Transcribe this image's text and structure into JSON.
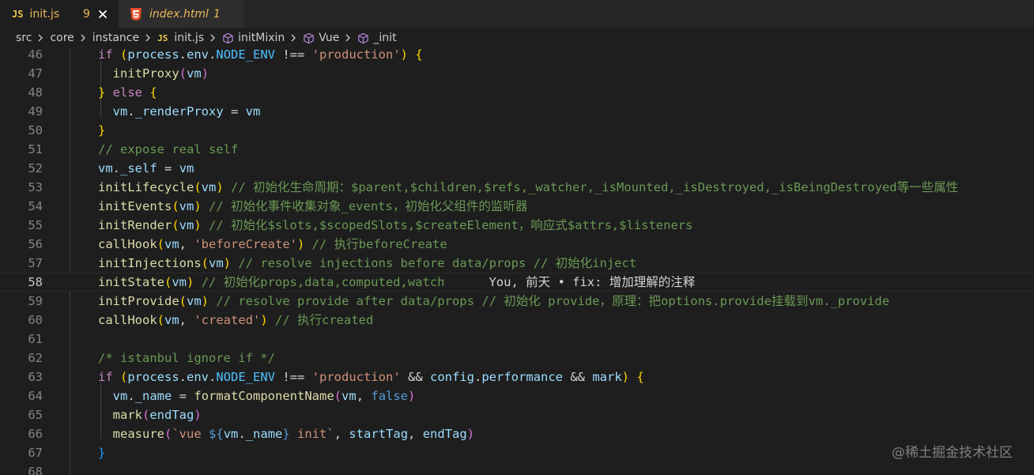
{
  "tabs": [
    {
      "icon": "JS",
      "label": "init.js",
      "problems": "9"
    },
    {
      "label": "index.html",
      "problems": "1"
    }
  ],
  "breadcrumb": [
    "src",
    "core",
    "instance",
    "init.js",
    "initMixin",
    "Vue",
    "_init"
  ],
  "breadcrumb_js_icon": "JS",
  "lines": [
    {
      "n": "46",
      "tokens": [
        [
          "if ",
          "ctrl"
        ],
        [
          "(",
          "gold"
        ],
        [
          "process",
          "var"
        ],
        [
          ".",
          "op"
        ],
        [
          "env",
          "var"
        ],
        [
          ".",
          "op"
        ],
        [
          "NODE_ENV",
          "const"
        ],
        [
          " !== ",
          "op"
        ],
        [
          "'production'",
          "str"
        ],
        [
          ") ",
          "gold"
        ],
        [
          "{",
          "gold"
        ]
      ]
    },
    {
      "n": "47",
      "tokens": [
        [
          "  ",
          "op"
        ],
        [
          "initProxy",
          "fn"
        ],
        [
          "(",
          "paren"
        ],
        [
          "vm",
          "var"
        ],
        [
          ")",
          "paren"
        ]
      ]
    },
    {
      "n": "48",
      "tokens": [
        [
          "} ",
          "gold"
        ],
        [
          "else ",
          "ctrl"
        ],
        [
          "{",
          "gold"
        ]
      ]
    },
    {
      "n": "49",
      "tokens": [
        [
          "  ",
          "op"
        ],
        [
          "vm",
          "var"
        ],
        [
          ".",
          "op"
        ],
        [
          "_renderProxy",
          "var"
        ],
        [
          " = ",
          "op"
        ],
        [
          "vm",
          "var"
        ]
      ]
    },
    {
      "n": "50",
      "tokens": [
        [
          "}",
          "gold"
        ]
      ]
    },
    {
      "n": "51",
      "tokens": [
        [
          "// expose real self",
          "cmt"
        ]
      ]
    },
    {
      "n": "52",
      "tokens": [
        [
          "vm",
          "var"
        ],
        [
          ".",
          "op"
        ],
        [
          "_self",
          "var"
        ],
        [
          " = ",
          "op"
        ],
        [
          "vm",
          "var"
        ]
      ]
    },
    {
      "n": "53",
      "tokens": [
        [
          "initLifecycle",
          "fn"
        ],
        [
          "(",
          "gold"
        ],
        [
          "vm",
          "var"
        ],
        [
          ")",
          "gold"
        ],
        [
          " // 初始化生命周期：$parent,$children,$refs,_watcher,_isMounted,_isDestroyed,_isBeingDestroyed等一些属性",
          "cmt"
        ]
      ]
    },
    {
      "n": "54",
      "tokens": [
        [
          "initEvents",
          "fn"
        ],
        [
          "(",
          "gold"
        ],
        [
          "vm",
          "var"
        ],
        [
          ")",
          "gold"
        ],
        [
          " // 初始化事件收集对象_events，初始化父组件的监听器",
          "cmt"
        ]
      ]
    },
    {
      "n": "55",
      "tokens": [
        [
          "initRender",
          "fn"
        ],
        [
          "(",
          "gold"
        ],
        [
          "vm",
          "var"
        ],
        [
          ")",
          "gold"
        ],
        [
          " // 初始化$slots,$scopedSlots,$createElement，响应式$attrs,$listeners",
          "cmt"
        ]
      ]
    },
    {
      "n": "56",
      "tokens": [
        [
          "callHook",
          "fn"
        ],
        [
          "(",
          "gold"
        ],
        [
          "vm",
          "var"
        ],
        [
          ", ",
          "op"
        ],
        [
          "'beforeCreate'",
          "str"
        ],
        [
          ")",
          "gold"
        ],
        [
          " // 执行beforeCreate",
          "cmt"
        ]
      ]
    },
    {
      "n": "57",
      "tokens": [
        [
          "initInjections",
          "fn"
        ],
        [
          "(",
          "gold"
        ],
        [
          "vm",
          "var"
        ],
        [
          ")",
          "gold"
        ],
        [
          " // resolve injections before data/props // 初始化inject",
          "cmt"
        ]
      ]
    },
    {
      "n": "58",
      "tokens": [
        [
          "initState",
          "fn"
        ],
        [
          "(",
          "gold"
        ],
        [
          "vm",
          "var"
        ],
        [
          ")",
          "gold"
        ],
        [
          " // 初始化props,data,computed,watch",
          "cmt"
        ],
        [
          "      You, 前天 • fix: 增加理解的注释",
          "blame"
        ]
      ]
    },
    {
      "n": "59",
      "tokens": [
        [
          "initProvide",
          "fn"
        ],
        [
          "(",
          "gold"
        ],
        [
          "vm",
          "var"
        ],
        [
          ")",
          "gold"
        ],
        [
          " // resolve provide after data/props // 初始化 provide，原理：把options.provide挂载到vm._provide",
          "cmt"
        ]
      ]
    },
    {
      "n": "60",
      "tokens": [
        [
          "callHook",
          "fn"
        ],
        [
          "(",
          "gold"
        ],
        [
          "vm",
          "var"
        ],
        [
          ", ",
          "op"
        ],
        [
          "'created'",
          "str"
        ],
        [
          ")",
          "gold"
        ],
        [
          " // 执行created",
          "cmt"
        ]
      ]
    },
    {
      "n": "61",
      "tokens": []
    },
    {
      "n": "62",
      "tokens": [
        [
          "/* istanbul ignore if */",
          "cmt"
        ]
      ]
    },
    {
      "n": "63",
      "tokens": [
        [
          "if ",
          "ctrl"
        ],
        [
          "(",
          "gold"
        ],
        [
          "process",
          "var"
        ],
        [
          ".",
          "op"
        ],
        [
          "env",
          "var"
        ],
        [
          ".",
          "op"
        ],
        [
          "NODE_ENV",
          "const"
        ],
        [
          " !== ",
          "op"
        ],
        [
          "'production'",
          "str"
        ],
        [
          " && ",
          "op"
        ],
        [
          "config",
          "var"
        ],
        [
          ".",
          "op"
        ],
        [
          "performance",
          "var"
        ],
        [
          " && ",
          "op"
        ],
        [
          "mark",
          "var"
        ],
        [
          ") ",
          "gold"
        ],
        [
          "{",
          "gold"
        ]
      ]
    },
    {
      "n": "64",
      "tokens": [
        [
          "  ",
          "op"
        ],
        [
          "vm",
          "var"
        ],
        [
          ".",
          "op"
        ],
        [
          "_name",
          "var"
        ],
        [
          " = ",
          "op"
        ],
        [
          "formatComponentName",
          "fn"
        ],
        [
          "(",
          "paren"
        ],
        [
          "vm",
          "var"
        ],
        [
          ", ",
          "op"
        ],
        [
          "false",
          "kw"
        ],
        [
          ")",
          "paren"
        ]
      ]
    },
    {
      "n": "65",
      "tokens": [
        [
          "  ",
          "op"
        ],
        [
          "mark",
          "fn"
        ],
        [
          "(",
          "paren"
        ],
        [
          "endTag",
          "var"
        ],
        [
          ")",
          "paren"
        ]
      ]
    },
    {
      "n": "66",
      "tokens": [
        [
          "  ",
          "op"
        ],
        [
          "measure",
          "fn"
        ],
        [
          "(",
          "paren"
        ],
        [
          "`vue ",
          "str"
        ],
        [
          "${",
          "kw"
        ],
        [
          "vm",
          "var"
        ],
        [
          ".",
          "op"
        ],
        [
          "_name",
          "var"
        ],
        [
          "}",
          "kw"
        ],
        [
          " init`",
          "str"
        ],
        [
          ", ",
          "op"
        ],
        [
          "startTag",
          "var"
        ],
        [
          ", ",
          "op"
        ],
        [
          "endTag",
          "var"
        ],
        [
          ")",
          "paren"
        ]
      ]
    },
    {
      "n": "67",
      "tokens": [
        [
          "}",
          "brace"
        ]
      ]
    },
    {
      "n": "68",
      "tokens": []
    }
  ],
  "current_line": "58",
  "watermark": "@稀土掘金技术社区",
  "colors": {
    "background": "#1e1e1e",
    "comment": "#6a9955",
    "function": "#dcdcaa",
    "variable": "#9cdcfe",
    "string": "#ce9178",
    "control_keyword": "#c586c0",
    "keyword": "#569cd6",
    "warning_tab": "#e9b75c"
  }
}
